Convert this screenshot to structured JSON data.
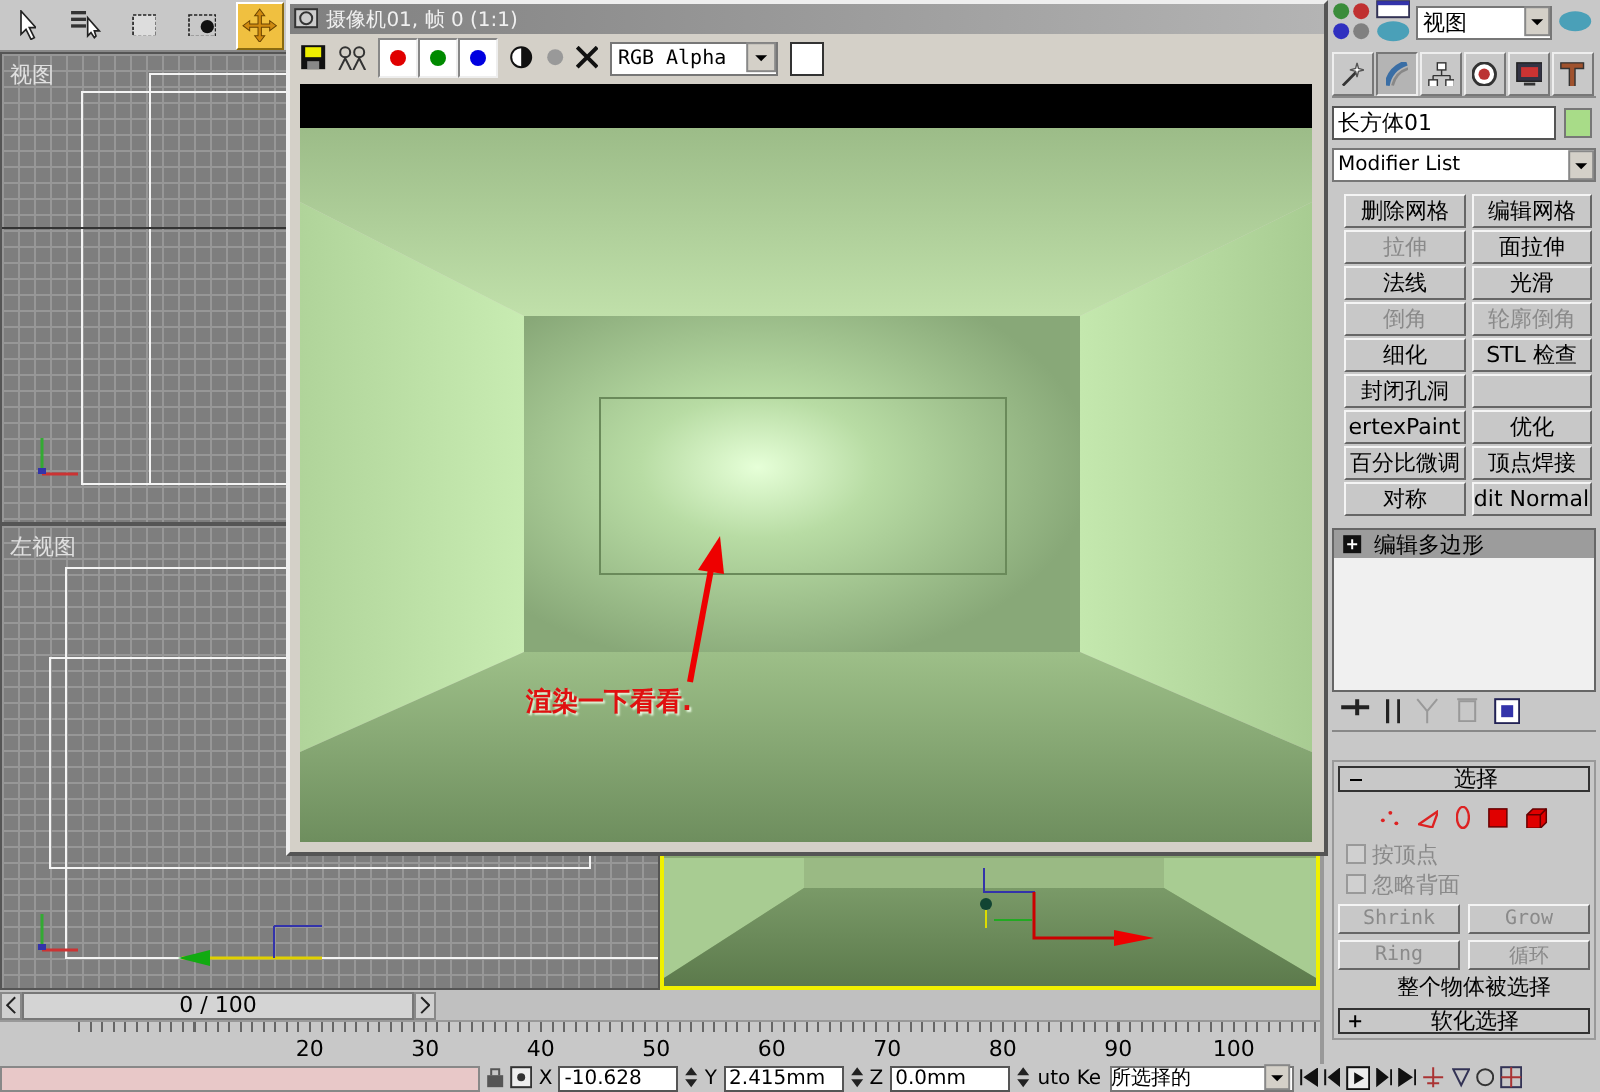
{
  "main_toolbar": {
    "tools": [
      {
        "kind": "select",
        "selected": false
      },
      {
        "kind": "select-by-name",
        "selected": false
      },
      {
        "kind": "region",
        "selected": false
      },
      {
        "kind": "window",
        "selected": false
      },
      {
        "kind": "move",
        "selected": true
      }
    ]
  },
  "viewports": [
    {
      "kind": "top",
      "label": "视图"
    },
    {
      "kind": "blank"
    },
    {
      "kind": "left",
      "label": "左视图"
    },
    {
      "kind": "perspective",
      "active": true
    }
  ],
  "render_window": {
    "title": "摄像机01, 帧 0 (1:1)",
    "channels": [
      {
        "color": "#e00000",
        "on": true
      },
      {
        "color": "#008a00",
        "on": true
      },
      {
        "color": "#0000e0",
        "on": true
      }
    ],
    "display": "RGB Alpha",
    "note": "渲染一下看看."
  },
  "command_panel": {
    "category": "视图",
    "tabs": [
      {
        "kind": "create",
        "selected": false
      },
      {
        "kind": "modify",
        "selected": true
      },
      {
        "kind": "hierarchy",
        "selected": false
      },
      {
        "kind": "motion",
        "selected": false
      },
      {
        "kind": "display",
        "selected": false
      },
      {
        "kind": "utilities",
        "selected": false
      }
    ],
    "object_name": "长方体01",
    "modifier_list": "Modifier List",
    "modifiers": [
      {
        "kind": "button",
        "label": "删除网格",
        "disabled": false
      },
      {
        "kind": "button",
        "label": "编辑网格",
        "disabled": false
      },
      {
        "kind": "button",
        "label": "拉伸",
        "disabled": true
      },
      {
        "kind": "button",
        "label": "面拉伸",
        "disabled": false
      },
      {
        "kind": "button",
        "label": "法线",
        "disabled": false
      },
      {
        "kind": "button",
        "label": "光滑",
        "disabled": false
      },
      {
        "kind": "button",
        "label": "倒角",
        "disabled": true
      },
      {
        "kind": "button",
        "label": "轮廓倒角",
        "disabled": true
      },
      {
        "kind": "button",
        "label": "细化",
        "disabled": false
      },
      {
        "kind": "button",
        "label": "STL 检查",
        "disabled": false
      },
      {
        "kind": "button",
        "label": "封闭孔洞",
        "disabled": false
      },
      {
        "kind": "blank"
      },
      {
        "kind": "button",
        "label": "ertexPaint",
        "disabled": false
      },
      {
        "kind": "button",
        "label": "优化",
        "disabled": false
      },
      {
        "kind": "button",
        "label": "百分比微调",
        "disabled": false
      },
      {
        "kind": "button",
        "label": "顶点焊接",
        "disabled": false
      },
      {
        "kind": "button",
        "label": "对称",
        "disabled": false
      },
      {
        "kind": "button",
        "label": "dit Normal",
        "disabled": false
      }
    ],
    "stack": [
      {
        "label": "编辑多边形",
        "selected": true
      }
    ],
    "rollouts": [
      {
        "title": "选择",
        "expanded": true,
        "subobjects": [
          {
            "kind": "vertex"
          },
          {
            "kind": "edge"
          },
          {
            "kind": "border"
          },
          {
            "kind": "polygon"
          },
          {
            "kind": "element"
          }
        ],
        "options": [
          {
            "label": "按顶点",
            "checked": false,
            "disabled": true
          },
          {
            "label": "忽略背面",
            "checked": false,
            "disabled": true
          }
        ],
        "buttons": [
          {
            "label": "Shrink",
            "disabled": true
          },
          {
            "label": "Grow",
            "disabled": true
          },
          {
            "label": "Ring",
            "disabled": true
          },
          {
            "label": "循环",
            "disabled": true
          }
        ],
        "info": "整个物体被选择"
      },
      {
        "title": "软化选择",
        "expanded": false
      }
    ]
  },
  "timeline": {
    "frame_counter": "0 / 100",
    "level": 0,
    "ruler": [
      "20",
      "30",
      "40",
      "50",
      "60",
      "70",
      "80",
      "90",
      "100"
    ]
  },
  "status_bar": {
    "coords": [
      {
        "axis": "X",
        "value": "-10.628"
      },
      {
        "axis": "Y",
        "value": "2.415mm"
      },
      {
        "axis": "Z",
        "value": "0.0mm"
      }
    ],
    "key_mode": "uto Ke",
    "selection_set": "所选择的"
  }
}
